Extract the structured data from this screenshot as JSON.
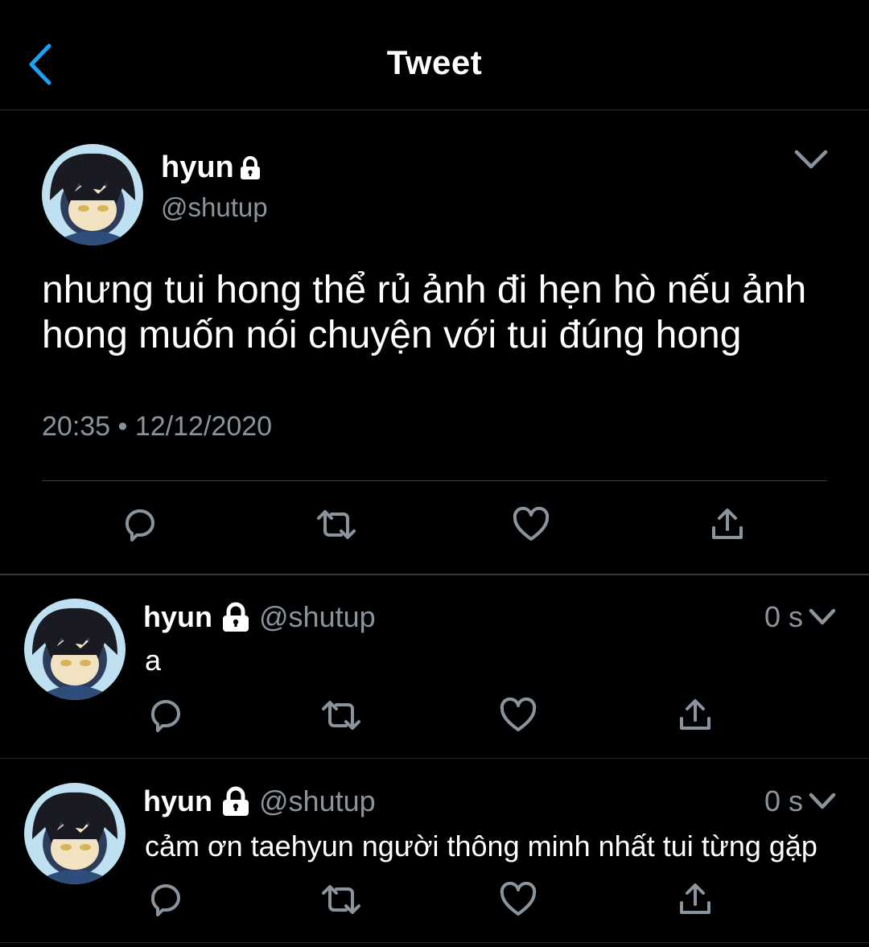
{
  "header": {
    "title": "Tweet"
  },
  "main_tweet": {
    "name": "hyun",
    "handle": "@shutup",
    "text": "nhưng tui hong thể rủ ảnh đi hẹn hò nếu ảnh hong muốn nói chuyện với tui đúng hong",
    "time": "20:35",
    "date": "12/12/2020",
    "meta": "20:35 • 12/12/2020"
  },
  "replies": [
    {
      "name": "hyun",
      "handle": "@shutup",
      "time": "0 s",
      "text": "a"
    },
    {
      "name": "hyun",
      "handle": "@shutup",
      "time": "0 s",
      "text": "cảm ơn taehyun người thông minh nhất tui từng gặp"
    }
  ],
  "colors": {
    "accent": "#1da1f2",
    "background": "#000000",
    "secondary_text": "#8b949c",
    "divider": "#3a3a3a"
  },
  "icons": [
    "back-arrow-icon",
    "lock-icon",
    "chevron-down-icon",
    "reply-icon",
    "retweet-icon",
    "like-icon",
    "share-icon"
  ]
}
